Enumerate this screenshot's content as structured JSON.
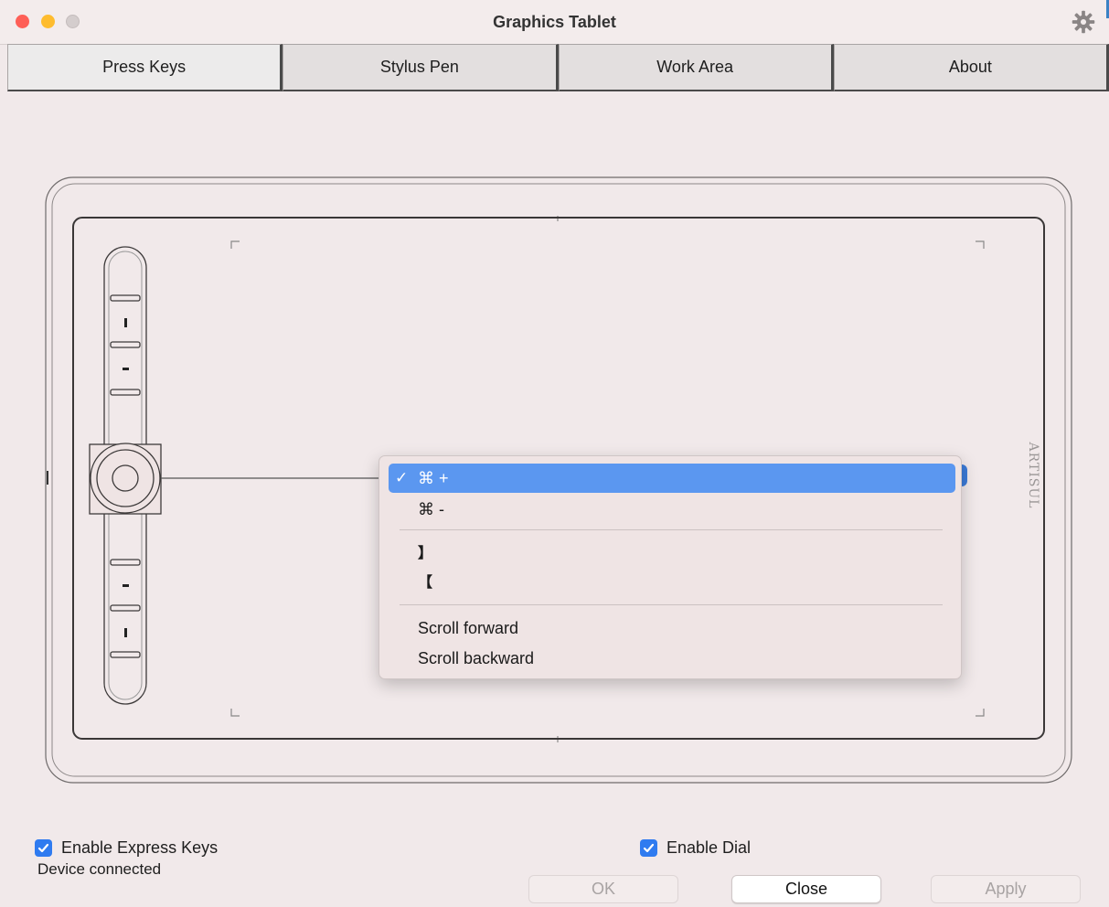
{
  "window": {
    "title": "Graphics Tablet"
  },
  "tabs": [
    {
      "label": "Press Keys",
      "active": true
    },
    {
      "label": "Stylus Pen",
      "active": false
    },
    {
      "label": "Work Area",
      "active": false
    },
    {
      "label": "About",
      "active": false
    }
  ],
  "tablet": {
    "brand_logo": "ARTISUL"
  },
  "dropdown_menu": {
    "items": [
      {
        "label": "⌘ +",
        "selected": true
      },
      {
        "label": "⌘ -",
        "selected": false
      },
      {
        "label": "】",
        "selected": false
      },
      {
        "label": "【",
        "selected": false
      },
      {
        "label": "Scroll forward",
        "selected": false
      },
      {
        "label": "Scroll backward",
        "selected": false
      }
    ],
    "check_mark": "✓"
  },
  "options": {
    "enable_express_keys": {
      "label": "Enable Express Keys",
      "checked": true
    },
    "enable_dial": {
      "label": "Enable Dial",
      "checked": true
    }
  },
  "status_text": "Device connected",
  "buttons": {
    "ok": {
      "label": "OK",
      "enabled": false
    },
    "close": {
      "label": "Close",
      "enabled": true
    },
    "apply": {
      "label": "Apply",
      "enabled": false
    }
  },
  "colors": {
    "accent": "#5b97f0",
    "checkbox": "#2f7bf0",
    "traffic_red": "#fe5f57",
    "traffic_yellow": "#febc2e",
    "window_bg": "#f1e9ea"
  }
}
